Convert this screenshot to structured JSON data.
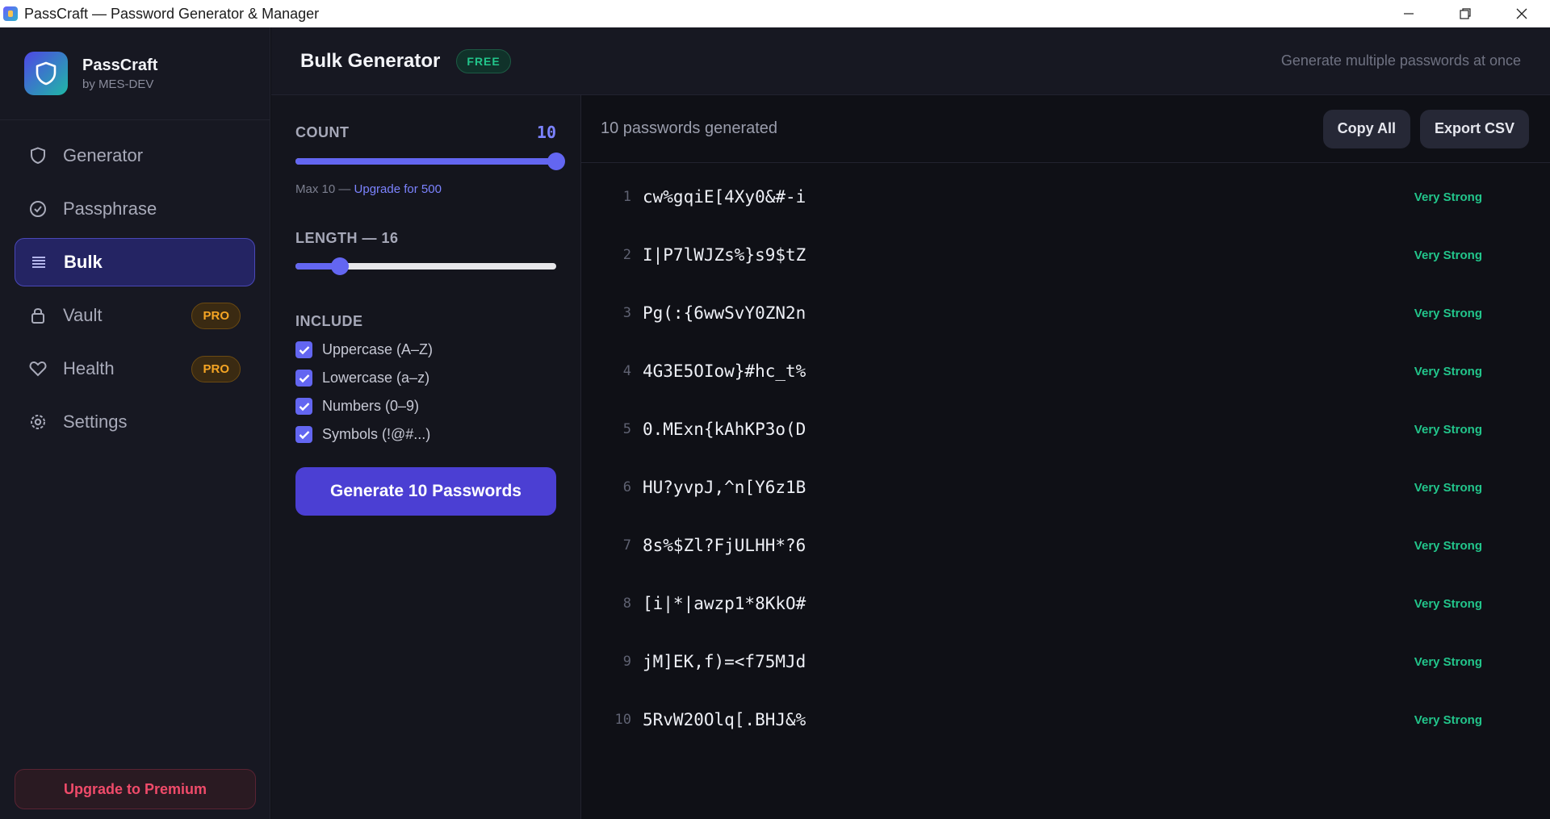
{
  "window": {
    "title": "PassCraft — Password Generator & Manager"
  },
  "brand": {
    "name": "PassCraft",
    "sub": "by MES-DEV"
  },
  "nav": [
    {
      "label": "Generator",
      "icon": "shield-icon"
    },
    {
      "label": "Passphrase",
      "icon": "check-circle-icon"
    },
    {
      "label": "Bulk",
      "icon": "list-icon",
      "active": true
    },
    {
      "label": "Vault",
      "icon": "lock-icon",
      "badge": "PRO"
    },
    {
      "label": "Health",
      "icon": "heart-icon",
      "badge": "PRO"
    },
    {
      "label": "Settings",
      "icon": "gear-icon"
    }
  ],
  "upgrade_label": "Upgrade to Premium",
  "header": {
    "title": "Bulk Generator",
    "badge": "FREE",
    "subtitle": "Generate multiple passwords at once"
  },
  "controls": {
    "count_label": "COUNT",
    "count_value": "10",
    "count_fraction": 1.0,
    "count_note_prefix": "Max 10 — ",
    "count_note_link": "Upgrade for 500",
    "length_label": "LENGTH — 16",
    "length_fraction": 0.17,
    "include_label": "INCLUDE",
    "options": [
      {
        "label": "Uppercase (A–Z)",
        "checked": true
      },
      {
        "label": "Lowercase (a–z)",
        "checked": true
      },
      {
        "label": "Numbers (0–9)",
        "checked": true
      },
      {
        "label": "Symbols (!@#...)",
        "checked": true
      }
    ],
    "generate_label": "Generate 10 Passwords"
  },
  "results": {
    "summary": "10 passwords generated",
    "copy_all": "Copy All",
    "export_csv": "Export CSV",
    "items": [
      {
        "n": "1",
        "pw": "cw%gqiE[4Xy0&#-i",
        "strength": "Very Strong"
      },
      {
        "n": "2",
        "pw": "I|P7lWJZs%}s9$tZ",
        "strength": "Very Strong"
      },
      {
        "n": "3",
        "pw": "Pg(:{6wwSvY0ZN2n",
        "strength": "Very Strong"
      },
      {
        "n": "4",
        "pw": "4G3E5OIow}#hc_t%",
        "strength": "Very Strong"
      },
      {
        "n": "5",
        "pw": "0.MExn{kAhKP3o(D",
        "strength": "Very Strong"
      },
      {
        "n": "6",
        "pw": "HU?yvpJ,^n[Y6z1B",
        "strength": "Very Strong"
      },
      {
        "n": "7",
        "pw": "8s%$Zl?FjULHH*?6",
        "strength": "Very Strong"
      },
      {
        "n": "8",
        "pw": "[i|*|awzp1*8KkO#",
        "strength": "Very Strong"
      },
      {
        "n": "9",
        "pw": "jM]EK,f)=<f75MJd",
        "strength": "Very Strong"
      },
      {
        "n": "10",
        "pw": "5RvW20Olq[.BHJ&%",
        "strength": "Very Strong"
      }
    ]
  },
  "colors": {
    "accent": "#6366f1",
    "strong": "#22c58b",
    "pro": "#f5a524",
    "danger": "#f04b6a"
  }
}
